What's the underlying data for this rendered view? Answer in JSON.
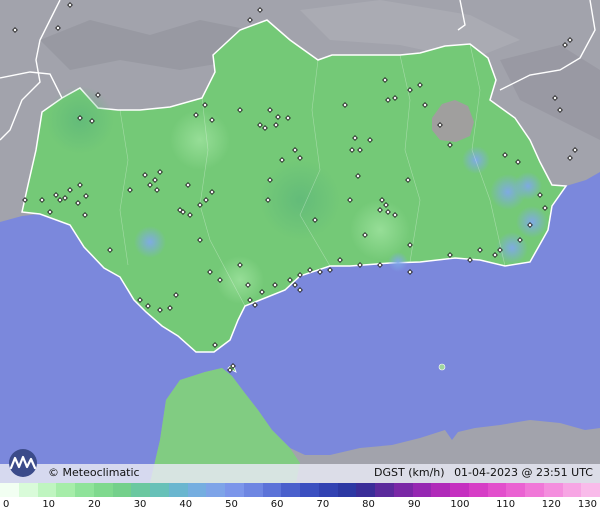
{
  "copyright": "© Meteoclimatic",
  "caption": {
    "variable": "DGST (km/h)",
    "datetime": "01-04-2023 @ 23:51 UTC"
  },
  "legend": {
    "ticks": [
      "0",
      "10",
      "20",
      "30",
      "40",
      "50",
      "60",
      "70",
      "80",
      "90",
      "100",
      "110",
      "120",
      "130"
    ],
    "min": 0,
    "max": 130,
    "colors": [
      "#f2fff2",
      "#d9fbd9",
      "#bff5c0",
      "#a6eda9",
      "#8fe39a",
      "#7fd98e",
      "#74d08b",
      "#6bc8a0",
      "#67c1b8",
      "#6ab6cf",
      "#75aee0",
      "#7ea4e8",
      "#7c96ea",
      "#6e86e2",
      "#5c73d8",
      "#4a60cc",
      "#3b4fc0",
      "#3242b2",
      "#2c38a3",
      "#3a2d98",
      "#5b2a9c",
      "#7a28a6",
      "#9628b2",
      "#b02ab9",
      "#c530c0",
      "#d63ec6",
      "#e24fcc",
      "#ea62d2",
      "#f078d8",
      "#f48fde",
      "#f7a6e4",
      "#f9bbea"
    ]
  },
  "colors": {
    "sea": "#7b88dc",
    "land_foreign": "#a2a3ac",
    "region_fill": "#74c977",
    "borders": "#ffffff"
  },
  "icons": {
    "logo": "meteoclimatic-logo",
    "station": "station-marker-icon"
  }
}
